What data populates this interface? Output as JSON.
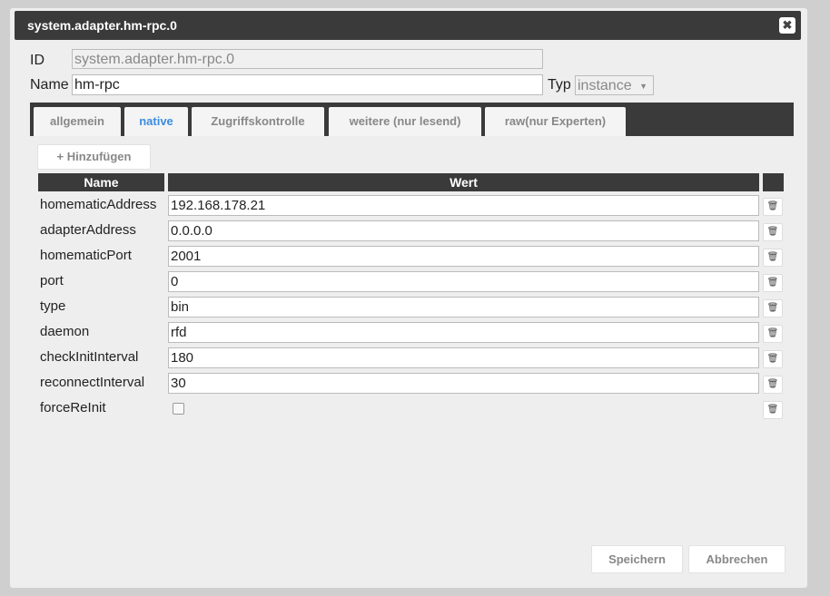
{
  "dialog": {
    "title": "system.adapter.hm-rpc.0",
    "close": "✖"
  },
  "form": {
    "id_label": "ID",
    "id_value": "system.adapter.hm-rpc.0",
    "name_label": "Name",
    "name_value": "hm-rpc",
    "typ_label": "Typ",
    "typ_value": "instance"
  },
  "tabs": [
    "allgemein",
    "native",
    "Zugriffskontrolle",
    "weitere (nur lesend)",
    "raw(nur Experten)"
  ],
  "add_button": "+  Hinzufügen",
  "table": {
    "headers": [
      "Name",
      "Wert"
    ],
    "rows": [
      {
        "name": "homematicAddress",
        "value": "192.168.178.21"
      },
      {
        "name": "adapterAddress",
        "value": "0.0.0.0"
      },
      {
        "name": "homematicPort",
        "value": "2001"
      },
      {
        "name": "port",
        "value": "0"
      },
      {
        "name": "type",
        "value": "bin"
      },
      {
        "name": "daemon",
        "value": "rfd"
      },
      {
        "name": "checkInitInterval",
        "value": "180"
      },
      {
        "name": "reconnectInterval",
        "value": "30"
      },
      {
        "name": "forceReInit",
        "value": false
      }
    ]
  },
  "footer": {
    "save": "Speichern",
    "cancel": "Abbrechen"
  }
}
